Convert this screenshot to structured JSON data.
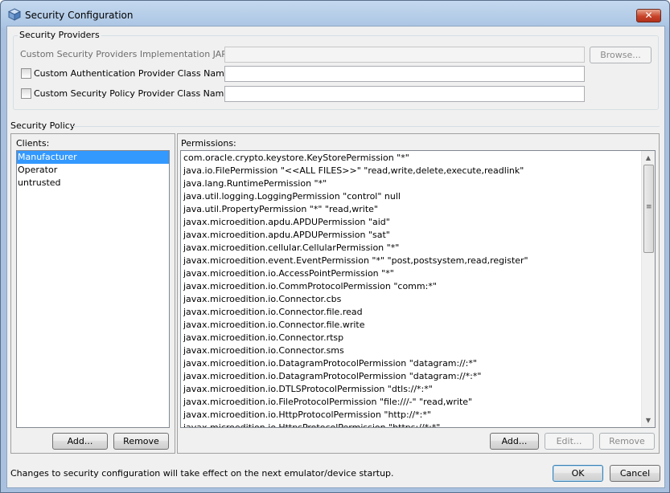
{
  "window": {
    "title": "Security Configuration",
    "close_glyph": "✕"
  },
  "providers": {
    "legend": "Security Providers",
    "jar_label": "Custom Security Providers Implementation JAR File:",
    "jar_value": "",
    "browse_label": "Browse...",
    "auth_label": "Custom Authentication Provider Class Name:",
    "auth_checked": false,
    "auth_value": "",
    "policy_label": "Custom Security Policy Provider Class Name:",
    "policy_checked": false,
    "policy_value": ""
  },
  "policy": {
    "legend": "Security Policy",
    "clients_label": "Clients:",
    "clients": [
      "Manufacturer",
      "Operator",
      "untrusted"
    ],
    "selected_client": "Manufacturer",
    "add_client_label": "Add...",
    "remove_client_label": "Remove",
    "permissions_label": "Permissions:",
    "permissions": [
      "com.oracle.crypto.keystore.KeyStorePermission \"*\"",
      "java.io.FilePermission \"<<ALL FILES>>\" \"read,write,delete,execute,readlink\"",
      "java.lang.RuntimePermission \"*\"",
      "java.util.logging.LoggingPermission \"control\" null",
      "java.util.PropertyPermission \"*\" \"read,write\"",
      "javax.microedition.apdu.APDUPermission \"aid\"",
      "javax.microedition.apdu.APDUPermission \"sat\"",
      "javax.microedition.cellular.CellularPermission \"*\"",
      "javax.microedition.event.EventPermission \"*\" \"post,postsystem,read,register\"",
      "javax.microedition.io.AccessPointPermission \"*\"",
      "javax.microedition.io.CommProtocolPermission \"comm:*\"",
      "javax.microedition.io.Connector.cbs",
      "javax.microedition.io.Connector.file.read",
      "javax.microedition.io.Connector.file.write",
      "javax.microedition.io.Connector.rtsp",
      "javax.microedition.io.Connector.sms",
      "javax.microedition.io.DatagramProtocolPermission \"datagram://:*\"",
      "javax.microedition.io.DatagramProtocolPermission \"datagram://*:*\"",
      "javax.microedition.io.DTLSProtocolPermission \"dtls://*:*\"",
      "javax.microedition.io.FileProtocolPermission \"file:///-\" \"read,write\"",
      "javax.microedition.io.HttpProtocolPermission \"http://*:*\"",
      "javax.microedition.io.HttpsProtocolPermission \"https://*:*\""
    ],
    "add_perm_label": "Add...",
    "edit_perm_label": "Edit...",
    "remove_perm_label": "Remove"
  },
  "footer": {
    "message": "Changes to security configuration will take effect on the next emulator/device startup.",
    "ok_label": "OK",
    "cancel_label": "Cancel"
  },
  "icons": {
    "window_icon": "cube-icon",
    "scroll_up": "▲",
    "scroll_down": "▼",
    "grip": "≡"
  }
}
